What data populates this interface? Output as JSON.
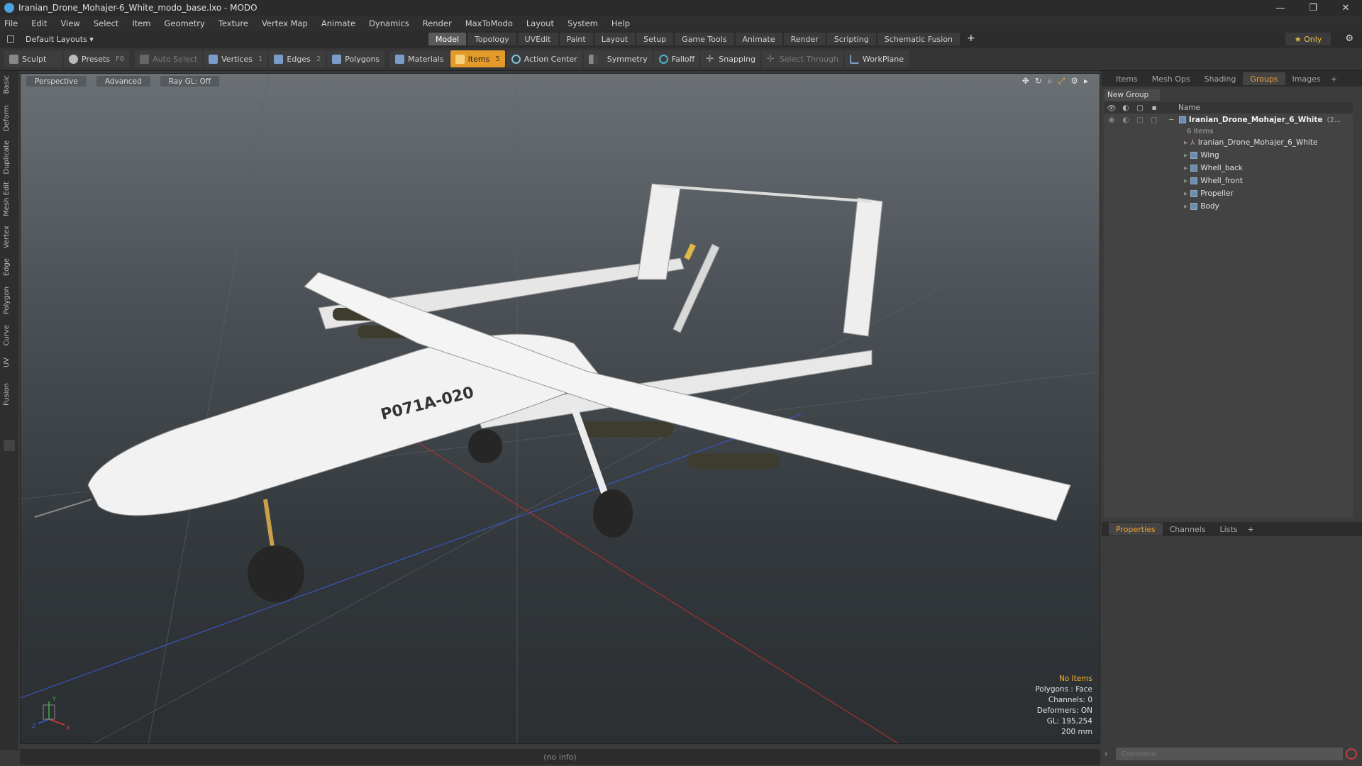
{
  "window": {
    "title": "Iranian_Drone_Mohajer-6_White_modo_base.lxo - MODO",
    "controls": [
      "—",
      "❐",
      "✕"
    ]
  },
  "menu": [
    "File",
    "Edit",
    "View",
    "Select",
    "Item",
    "Geometry",
    "Texture",
    "Vertex Map",
    "Animate",
    "Dynamics",
    "Render",
    "MaxToModo",
    "Layout",
    "System",
    "Help"
  ],
  "layout_selector": "Default Layouts ▾",
  "tabs": [
    "Model",
    "Topology",
    "UVEdit",
    "Paint",
    "Layout",
    "Setup",
    "Game Tools",
    "Animate",
    "Render",
    "Scripting",
    "Schematic Fusion"
  ],
  "active_tab": "Model",
  "only_label": "★  Only",
  "toolbar": {
    "sculpt": "Sculpt",
    "presets": "Presets",
    "presets_key": "F6",
    "auto_select": "Auto Select",
    "vertices": "Vertices",
    "vertices_key": "1",
    "edges": "Edges",
    "edges_key": "2",
    "polygons": "Polygons",
    "materials": "Materials",
    "items": "Items",
    "items_key": "5",
    "action_center": "Action Center",
    "symmetry": "Symmetry",
    "falloff": "Falloff",
    "snapping": "Snapping",
    "select_through": "Select Through",
    "workplane": "WorkPlane"
  },
  "left_strip": [
    "Basic",
    "Deform",
    "Duplicate",
    "Mesh Edit",
    "Vertex",
    "Edge",
    "Polygon",
    "Curve",
    "UV",
    "Fusion"
  ],
  "viewport": {
    "view": "Perspective",
    "shading": "Advanced",
    "raygl": "Ray GL: Off",
    "tail_number": "P071A-020",
    "info": {
      "selection": "No Items",
      "polygons": "Polygons : Face",
      "channels": "Channels: 0",
      "deformers": "Deformers: ON",
      "gl": "GL: 195,254",
      "size": "200 mm"
    },
    "axes": {
      "y": "Y",
      "x": "X",
      "z": "Z"
    }
  },
  "status": "(no info)",
  "right_tabs": [
    "Items",
    "Mesh Ops",
    "Shading",
    "Groups",
    "Images"
  ],
  "right_active_tab": "Groups",
  "new_group": "New Group",
  "tree_header": {
    "name": "Name"
  },
  "tree": {
    "root": "Iranian_Drone_Mohajer_6_White",
    "root_suffix": "(2...",
    "root_count": "6 Items",
    "children": [
      "Iranian_Drone_Mohajer_6_White",
      "Wing",
      "Whell_back",
      "Whell_front",
      "Propeller",
      "Body"
    ]
  },
  "props_tabs": [
    "Properties",
    "Channels",
    "Lists"
  ],
  "props_active": "Properties",
  "command_placeholder": "Command",
  "colors": {
    "accent": "#e39a2b",
    "warn": "#f2b22a"
  }
}
